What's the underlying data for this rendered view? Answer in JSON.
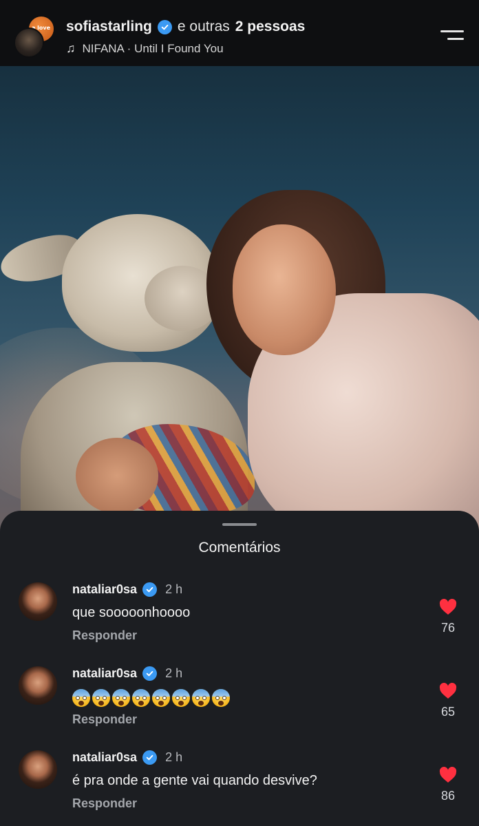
{
  "header": {
    "username": "sofiastarling",
    "others_prefix": "e outras",
    "others_count": "2 pessoas",
    "music": "NIFANA · Until I Found You",
    "back_avatar_text": "a love"
  },
  "icons": {
    "verified": "verified-badge-icon",
    "music": "music-note-icon",
    "menu": "menu-icon",
    "like": "heart-icon"
  },
  "colors": {
    "verified": "#3b9af3",
    "heart": "#ff3040",
    "sheet_bg": "#1c1e22"
  },
  "comments_sheet": {
    "title": "Comentários",
    "comments": [
      {
        "username": "nataliar0sa",
        "time": "2 h",
        "text": "que sooooonhoooo",
        "reply": "Responder",
        "likes": "76"
      },
      {
        "username": "nataliar0sa",
        "time": "2 h",
        "text": "😱😱😱😱😱😱😱😱",
        "emoji_count": 8,
        "reply": "Responder",
        "likes": "65"
      },
      {
        "username": "nataliar0sa",
        "time": "2 h",
        "text": "é pra onde a gente vai quando desvive?",
        "reply": "Responder",
        "likes": "86"
      }
    ]
  }
}
